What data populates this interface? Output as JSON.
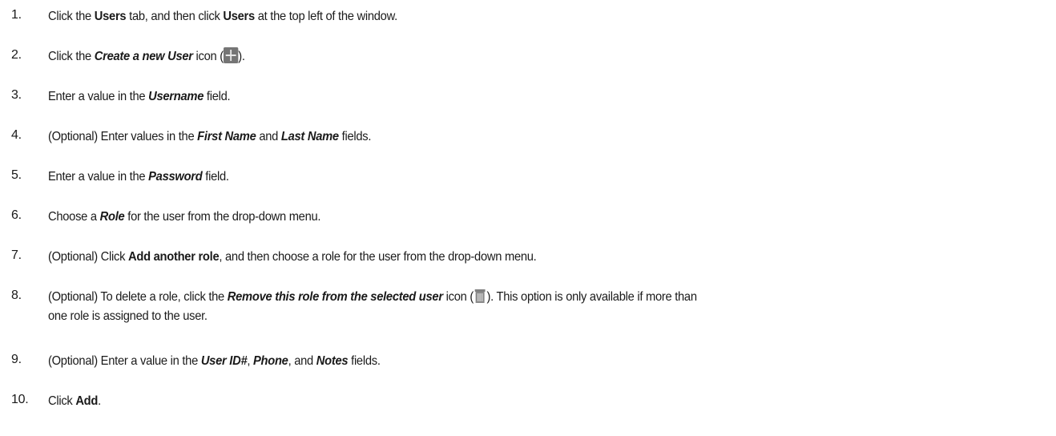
{
  "steps": [
    {
      "number": "1.",
      "parts": [
        "Click the ",
        "Users",
        " tab, and then click ",
        "Users",
        " at the top left of the window."
      ]
    },
    {
      "number": "2.",
      "parts": [
        "Click the ",
        "Create a new User",
        " icon (",
        ")."
      ],
      "icon": "plus-icon"
    },
    {
      "number": "3.",
      "parts": [
        "Enter a value in the ",
        "Username",
        " field."
      ]
    },
    {
      "number": "4.",
      "parts": [
        "(Optional) Enter values in the ",
        "First Name",
        " and ",
        "Last Name",
        " fields."
      ]
    },
    {
      "number": "5.",
      "parts": [
        "Enter a value in the ",
        "Password",
        " field."
      ]
    },
    {
      "number": "6.",
      "parts": [
        "Choose a ",
        "Role",
        " for the user from the drop-down menu."
      ]
    },
    {
      "number": "7.",
      "parts": [
        "(Optional) Click ",
        "Add another role",
        ", and then choose a role for the user from the drop-down menu."
      ]
    },
    {
      "number": "8.",
      "parts": [
        "(Optional) To delete a role, click the ",
        "Remove this role from the selected user",
        " icon (",
        "). This option is only available if more than",
        "one role is assigned to the user."
      ],
      "icon": "trash-icon"
    },
    {
      "number": "9.",
      "parts": [
        "(Optional) Enter a value in the ",
        "User ID#",
        ", ",
        "Phone",
        ", and ",
        "Notes",
        " fields."
      ]
    },
    {
      "number": "10.",
      "parts": [
        "Click ",
        "Add",
        "."
      ]
    }
  ]
}
